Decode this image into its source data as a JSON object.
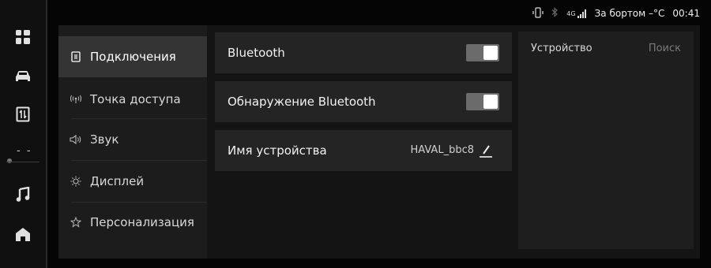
{
  "status": {
    "network": "4G",
    "outside_temp": "За бортом –°C",
    "clock": "00:41"
  },
  "rail": {
    "icons": [
      "apps-grid-icon",
      "car-icon",
      "phone-projection-icon",
      "music-icon",
      "home-icon"
    ],
    "climate_dash": "- -"
  },
  "menu": {
    "items": [
      {
        "label": "Подключения",
        "icon": "link-icon",
        "active": true
      },
      {
        "label": "Точка доступа",
        "icon": "hotspot-icon",
        "active": false
      },
      {
        "label": "Звук",
        "icon": "speaker-icon",
        "active": false
      },
      {
        "label": "Дисплей",
        "icon": "brightness-icon",
        "active": false
      },
      {
        "label": "Персонализация",
        "icon": "personalize-icon",
        "active": false
      }
    ]
  },
  "settings": {
    "bluetooth_label": "Bluetooth",
    "bluetooth_on": true,
    "discovery_label": "Обнаружение Bluetooth",
    "discovery_on": true,
    "device_name_label": "Имя устройства",
    "device_name_value": "HAVAL_bbc8"
  },
  "devices": {
    "title": "Устройство",
    "search_label": "Поиск"
  },
  "colors": {
    "background": "#000000",
    "menu_bg": "#1c1c1c",
    "menu_active": "#343434",
    "row_bg": "#242424",
    "toggle_track": "#6b6b6b"
  }
}
